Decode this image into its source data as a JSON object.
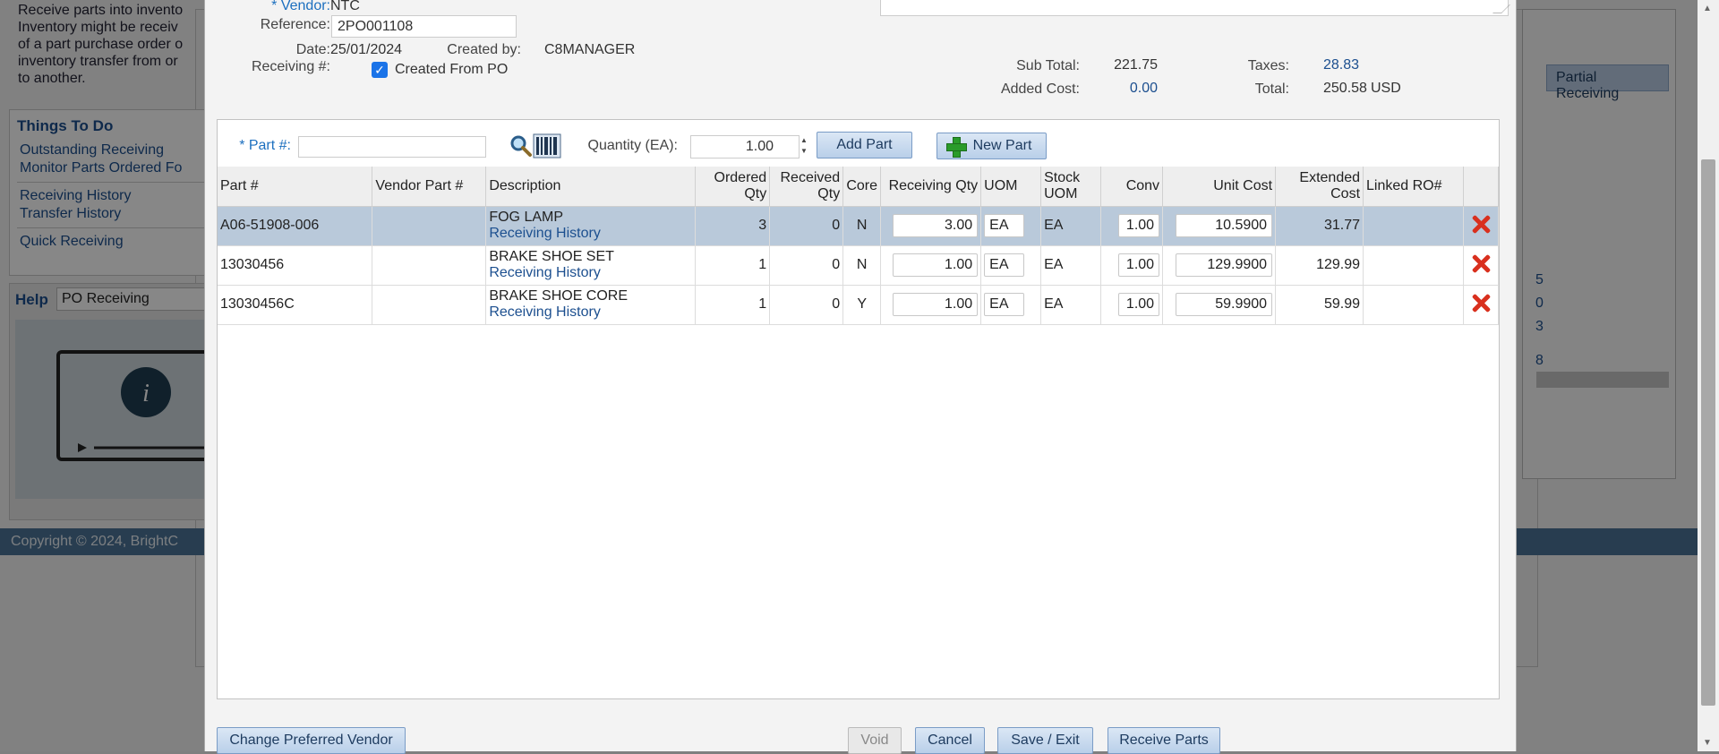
{
  "background": {
    "description_lines": [
      "Receive parts into invento",
      "Inventory might be receiv",
      "of a part purchase order o",
      "inventory transfer from or",
      "to another."
    ],
    "things_to_do": {
      "title": "Things To Do",
      "links": [
        "Outstanding Receiving",
        "Monitor Parts Ordered Fo",
        "Receiving History",
        "Transfer History",
        "Quick Receiving"
      ]
    },
    "help": {
      "title": "Help",
      "selected": "PO Receiving"
    },
    "footer": "Copyright © 2024, BrightC",
    "partial_receiving_button": "Partial Receiving",
    "right_numbers": [
      "5",
      "0",
      "3",
      "8"
    ]
  },
  "header": {
    "vendor_label": "* Vendor:",
    "vendor_value": "NTC",
    "reference_label": "Reference:",
    "reference_value": "2PO001108",
    "date_label": "Date:",
    "date_value": "25/01/2024",
    "created_by_label": "Created by:",
    "created_by_value": "C8MANAGER",
    "receiving_num_label": "Receiving #:",
    "created_from_po_label": "Created From PO",
    "created_from_po_checked": true
  },
  "totals": {
    "sub_total_label": "Sub Total:",
    "sub_total_value": "221.75",
    "added_cost_label": "Added Cost:",
    "added_cost_value": "0.00",
    "taxes_label": "Taxes:",
    "taxes_value": "28.83",
    "total_label": "Total:",
    "total_value": "250.58",
    "currency": "USD"
  },
  "toolbar": {
    "part_num_label": "* Part #:",
    "quantity_label": "Quantity (EA):",
    "quantity_value": "1.00",
    "add_part": "Add Part",
    "new_part": "New Part"
  },
  "grid": {
    "columns": [
      "Part #",
      "Vendor Part #",
      "Description",
      "Ordered Qty",
      "Received Qty",
      "Core",
      "Receiving Qty",
      "UOM",
      "Stock UOM",
      "Conv",
      "Unit Cost",
      "Extended Cost",
      "Linked RO#",
      ""
    ],
    "history_link": "Receiving History",
    "rows": [
      {
        "part": "A06-51908-006",
        "vendor_part": "",
        "description": "FOG LAMP",
        "ordered": "3",
        "received": "0",
        "core": "N",
        "receiving_qty": "3.00",
        "uom": "EA",
        "stock_uom": "EA",
        "conv": "1.00",
        "unit_cost": "10.5900",
        "extended": "31.77",
        "linked_ro": "",
        "selected": true
      },
      {
        "part": "13030456",
        "vendor_part": "",
        "description": "BRAKE SHOE SET",
        "ordered": "1",
        "received": "0",
        "core": "N",
        "receiving_qty": "1.00",
        "uom": "EA",
        "stock_uom": "EA",
        "conv": "1.00",
        "unit_cost": "129.9900",
        "extended": "129.99",
        "linked_ro": "",
        "selected": false
      },
      {
        "part": "13030456C",
        "vendor_part": "",
        "description": "BRAKE SHOE CORE",
        "ordered": "1",
        "received": "0",
        "core": "Y",
        "receiving_qty": "1.00",
        "uom": "EA",
        "stock_uom": "EA",
        "conv": "1.00",
        "unit_cost": "59.9900",
        "extended": "59.99",
        "linked_ro": "",
        "selected": false
      }
    ]
  },
  "footer_buttons": {
    "change_vendor": "Change Preferred Vendor",
    "void": "Void",
    "cancel": "Cancel",
    "save_exit": "Save / Exit",
    "receive_parts": "Receive Parts"
  }
}
